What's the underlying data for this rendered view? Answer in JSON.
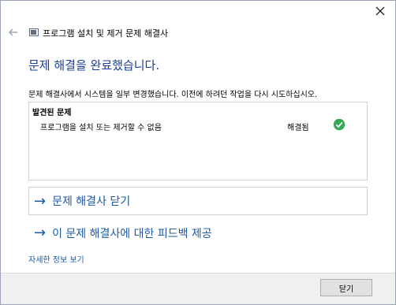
{
  "window": {
    "close_icon": "close-icon"
  },
  "header": {
    "back_icon": "back-arrow-icon",
    "app_icon": "troubleshooter-icon",
    "title": "프로그램 설치 및 제거 문제 해결사"
  },
  "main": {
    "headline": "문제 해결을 완료했습니다.",
    "description": "문제 해결사에서 시스템을 일부 변경했습니다. 이전에 하려던 작업을 다시 시도하십시오.",
    "panel": {
      "title": "발견된 문제",
      "issues": [
        {
          "name": "프로그램을 설치 또는 제거할 수 없음",
          "status": "해결됨",
          "status_icon": "check-circle-icon",
          "status_color": "#34a853"
        }
      ]
    },
    "links": {
      "close_troubleshooter": "문제 해결사 닫기",
      "feedback": "이 문제 해결사에 대한 피드백 제공",
      "more_info": "자세한 정보 보기",
      "arrow_glyph": "→"
    }
  },
  "footer": {
    "close_button": "닫기"
  },
  "colors": {
    "accent_text": "#1c3f95",
    "link": "#1c5aa6",
    "footer_bg": "#f0f0f0"
  }
}
